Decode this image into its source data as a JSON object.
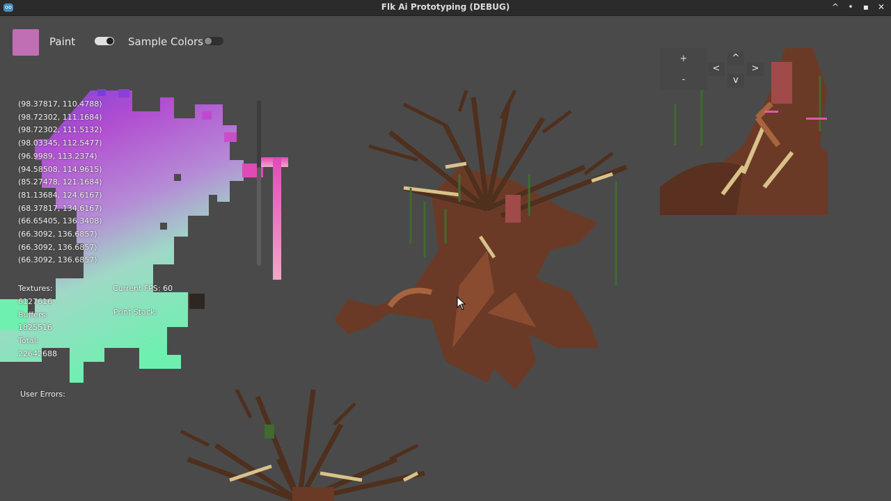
{
  "window": {
    "title": "Flk Ai Prototyping (DEBUG)",
    "minimize": "^",
    "restore": "•",
    "maximize": "▪",
    "close": "✕"
  },
  "toolbar": {
    "paint_color": "#c06fb5",
    "paint_label": "Paint",
    "paint_toggle_on": true,
    "sample_label": "Sample Colors",
    "sample_toggle_on": false
  },
  "coords": [
    "(98.37817, 110.4788)",
    "(98.72302, 111.1684)",
    "(98.72302, 111.5132)",
    "(98.03345, 112.5477)",
    "(96.9989, 113.2374)",
    "(94.58508, 114.9615)",
    "(85.27478, 121.1684)",
    "(81.13684, 124.6167)",
    "(68.37817, 134.6167)",
    "(66.65405, 136.3408)",
    "(66.3092, 136.6857)",
    "(66.3092, 136.6857)",
    "(66.3092, 136.6857)"
  ],
  "stats": {
    "textures_label": "Textures:",
    "textures_value": "6127616",
    "buffers_label": "Buffers:",
    "buffers_value": "1825516",
    "total_label": "Total:",
    "total_value": "22642688",
    "fps_text": "Current FPS: 60",
    "print_stack_label": "Print Stack:",
    "user_errors_label": "User Errors:"
  },
  "zoom": {
    "plus": "+",
    "minus": "-"
  },
  "nav": {
    "up": "^",
    "left": "<",
    "right": ">",
    "down": "v"
  },
  "icons": {
    "app": "godot-app-icon",
    "cursor": "mouse-pointer-icon"
  },
  "colors": {
    "background": "#4a4a4a",
    "titlebar": "#2b2b2b",
    "bark": "#6b3a26",
    "branch": "#4f2f1d",
    "highlight": "#d9c28a",
    "moss": "#3f6b2f"
  }
}
